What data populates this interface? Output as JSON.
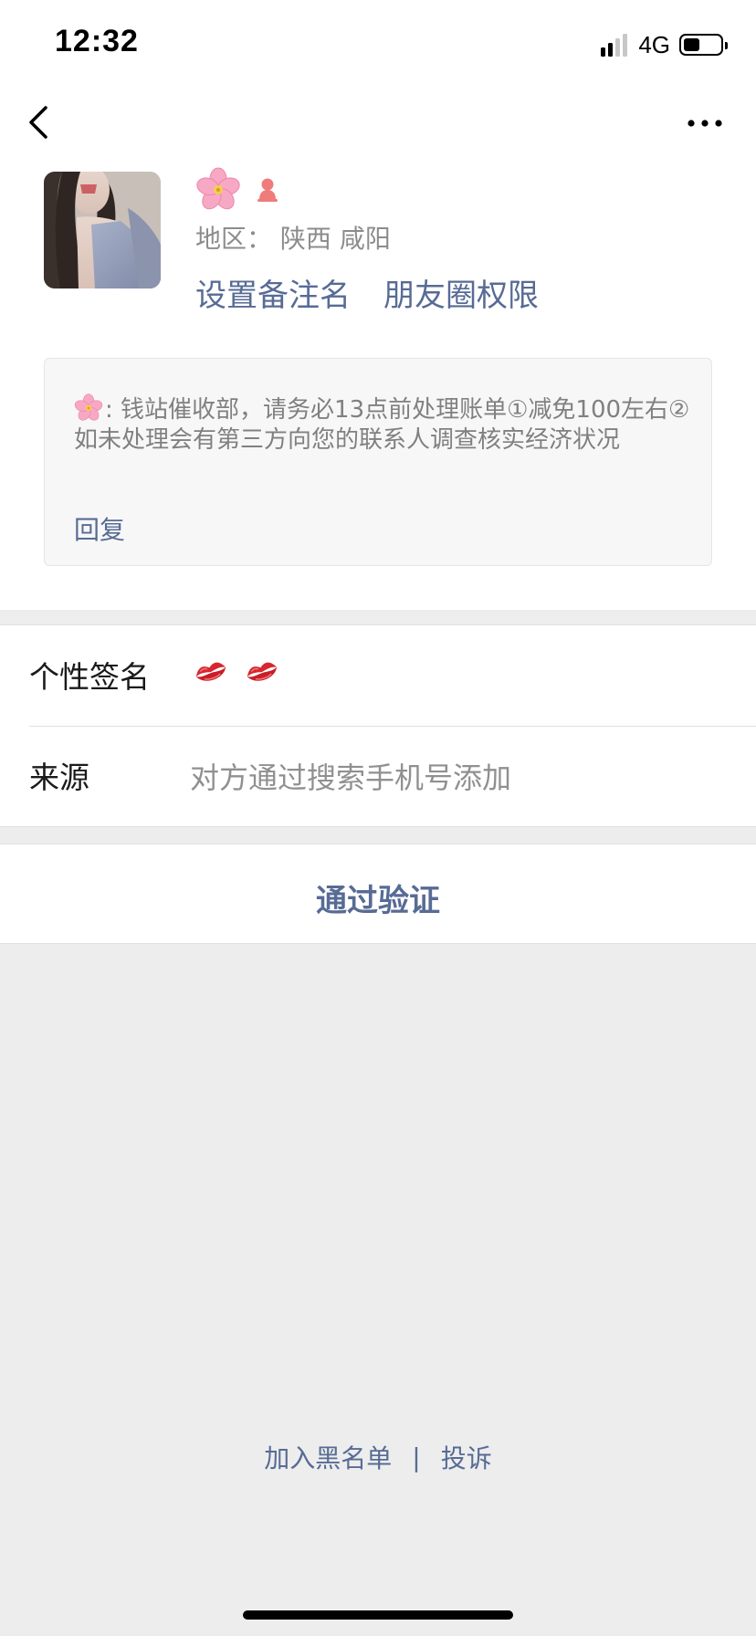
{
  "status_bar": {
    "time": "12:32",
    "network": "4G",
    "battery_level": 0.45
  },
  "nav": {
    "back_icon": "chevron-left-icon",
    "more_icon": "more-dots-icon"
  },
  "profile": {
    "nickname_icon": "cherry-blossom-emoji",
    "gender_icon": "female-icon",
    "gender_color": "#f07b7b",
    "region_label": "地区：",
    "region_value": "陕西 咸阳",
    "set_remark": "设置备注名",
    "moments_permission": "朋友圈权限"
  },
  "message": {
    "sender_icon": "cherry-blossom-emoji",
    "text": ": 钱站催收部，请务必13点前处理账单①减免100左右②如未处理会有第三方向您的联系人调查核实经济状况",
    "reply": "回复"
  },
  "info": {
    "signature_label": "个性签名",
    "signature_icons": [
      "kiss-lips-icon",
      "kiss-lips-icon"
    ],
    "source_label": "来源",
    "source_value": "对方通过搜索手机号添加"
  },
  "verify": {
    "label": "通过验证"
  },
  "footer": {
    "blacklist": "加入黑名单",
    "separator": "|",
    "report": "投诉"
  },
  "colors": {
    "link": "#576b95",
    "background": "#ededed",
    "card": "#ffffff",
    "muted_text": "#8c8c8c"
  }
}
